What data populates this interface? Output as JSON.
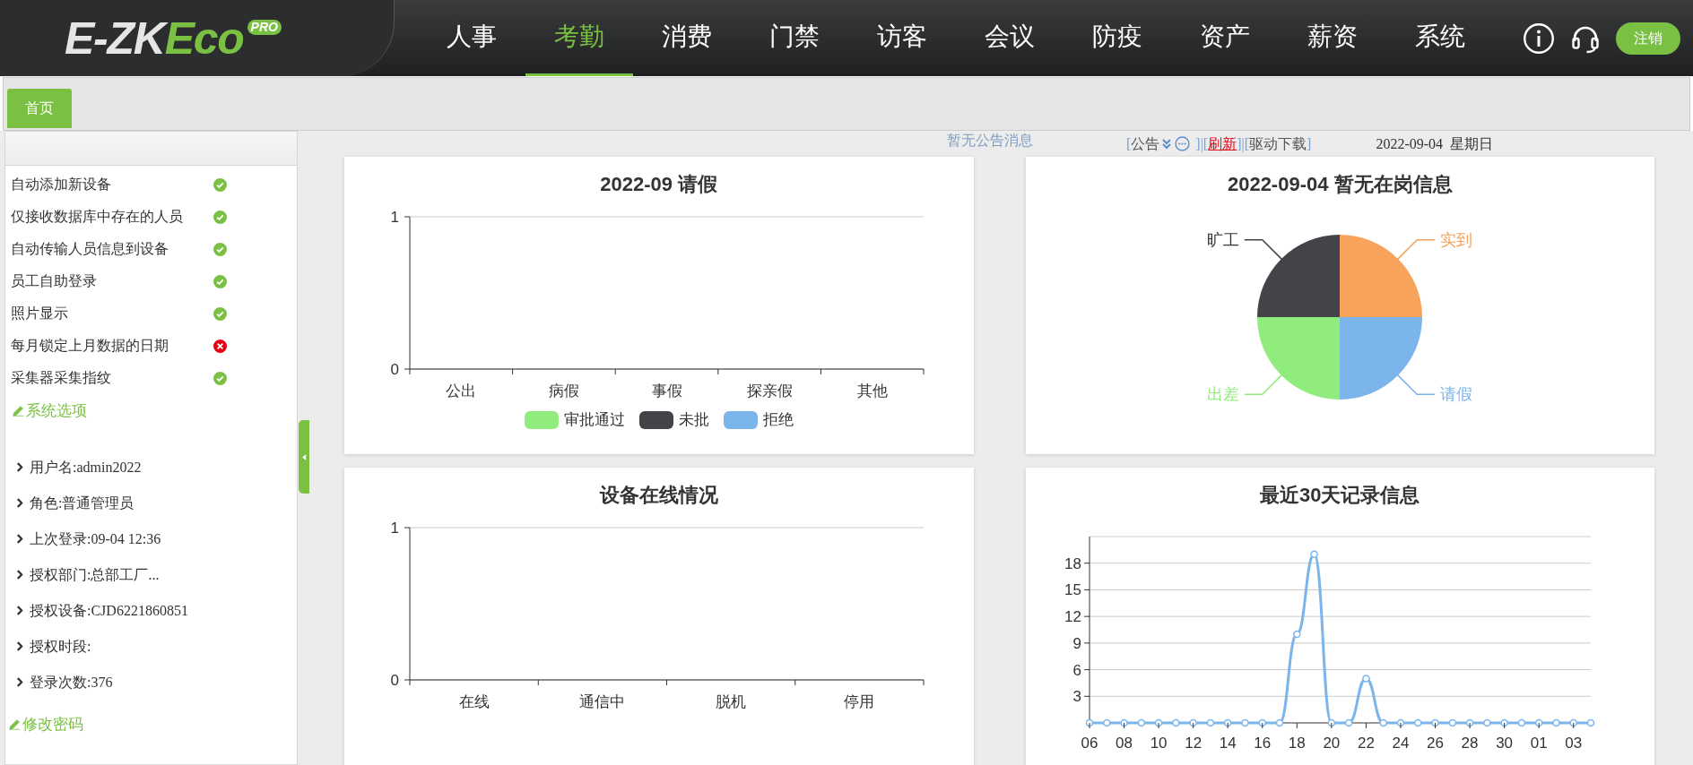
{
  "header": {
    "logo": {
      "prefix": "E-ZK",
      "suffix": "Eco",
      "badge": "PRO"
    },
    "nav": [
      {
        "label": "人事",
        "selected": false
      },
      {
        "label": "考勤",
        "selected": true
      },
      {
        "label": "消费",
        "selected": false
      },
      {
        "label": "门禁",
        "selected": false
      },
      {
        "label": "访客",
        "selected": false
      },
      {
        "label": "会议",
        "selected": false
      },
      {
        "label": "防疫",
        "selected": false
      },
      {
        "label": "资产",
        "selected": false
      },
      {
        "label": "薪资",
        "selected": false
      },
      {
        "label": "系统",
        "selected": false
      }
    ],
    "logout": "注销"
  },
  "tabs": [
    {
      "label": "首页",
      "selected": true
    }
  ],
  "sidebar": {
    "settings": [
      {
        "label": "自动添加新设备",
        "on": true
      },
      {
        "label": "仅接收数据库中存在的人员",
        "on": true
      },
      {
        "label": "自动传输人员信息到设备",
        "on": true
      },
      {
        "label": "员工自助登录",
        "on": true
      },
      {
        "label": "照片显示",
        "on": true
      },
      {
        "label": "每月锁定上月数据的日期",
        "on": false
      },
      {
        "label": "采集器采集指纹",
        "on": true
      }
    ],
    "system_options": "系统选项",
    "user_info": [
      "用户名:admin2022",
      "角色:普通管理员",
      "上次登录:09-04 12:36",
      "授权部门:总部工厂...",
      "授权设备:CJD6221860851",
      "授权时段:",
      "登录次数:376"
    ],
    "change_password": "修改密码"
  },
  "notice": "暂无公告消息",
  "toolbar": {
    "open_bracket": "[",
    "announcement": "公告",
    "separator_1": "]|[",
    "refresh": "刷新",
    "separator_2": "]|[",
    "driver_download": "驱动下载",
    "close_bracket": "]",
    "date": "2022-09-04  星期日"
  },
  "cards": [
    {
      "title": "2022-09 请假",
      "chart_data": {
        "type": "bar",
        "categories": [
          "公出",
          "病假",
          "事假",
          "探亲假",
          "其他"
        ],
        "series": [
          {
            "name": "审批通过",
            "color": "#90ed7d",
            "values": [
              0,
              0,
              0,
              0,
              0
            ]
          },
          {
            "name": "未批",
            "color": "#434348",
            "values": [
              0,
              0,
              0,
              0,
              0
            ]
          },
          {
            "name": "拒绝",
            "color": "#7cb5ec",
            "values": [
              0,
              0,
              0,
              0,
              0
            ]
          }
        ],
        "ylim": [
          0,
          1
        ],
        "yticks": [
          0,
          1
        ]
      }
    },
    {
      "title": "2022-09-04 暂无在岗信息",
      "chart_data": {
        "type": "pie",
        "categories": [
          "实到",
          "请假",
          "出差",
          "旷工"
        ],
        "series": [
          {
            "values": [
              25,
              25,
              25,
              25
            ],
            "colors": [
              "#f7a35c",
              "#7cb5ec",
              "#90ed7d",
              "#434348"
            ]
          }
        ]
      }
    },
    {
      "title": "设备在线情况",
      "chart_data": {
        "type": "bar",
        "categories": [
          "在线",
          "通信中",
          "脱机",
          "停用"
        ],
        "series": [
          {
            "values": [
              0,
              0,
              0,
              0
            ]
          }
        ],
        "ylim": [
          0,
          1
        ],
        "yticks": [
          0,
          1
        ]
      }
    },
    {
      "title": "最近30天记录信息",
      "chart_data": {
        "type": "line",
        "categories": [
          "06",
          null,
          "08",
          null,
          "10",
          null,
          "12",
          null,
          "14",
          null,
          "16",
          null,
          "18",
          null,
          "20",
          null,
          "22",
          null,
          "24",
          null,
          "26",
          null,
          "28",
          null,
          "30",
          null,
          "01",
          null,
          "03",
          null
        ],
        "series": [
          {
            "color": "#7cb5ec",
            "marker": true,
            "values": [
              0,
              0,
              0,
              0,
              0,
              0,
              0,
              0,
              0,
              0,
              0,
              0,
              10,
              19,
              0,
              0,
              5,
              0,
              0,
              0,
              0,
              0,
              0,
              0,
              0,
              0,
              0,
              0,
              0,
              0
            ]
          }
        ],
        "ylim": [
          0,
          21
        ],
        "yticks": [
          3,
          6,
          9,
          12,
          15,
          18
        ],
        "grid": true
      }
    }
  ]
}
